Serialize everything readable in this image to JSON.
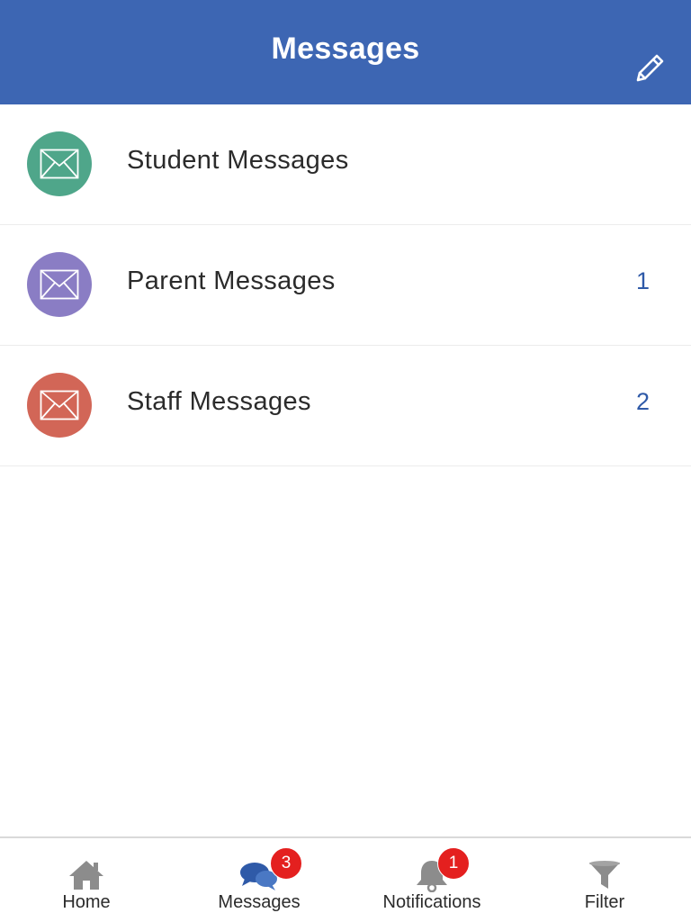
{
  "header": {
    "title": "Messages",
    "compose_icon": "pencil-icon",
    "background": "#3d66b3"
  },
  "list": {
    "items": [
      {
        "label": "Student Messages",
        "count": "",
        "icon": "envelope-icon",
        "color": "#4fa68a"
      },
      {
        "label": "Parent Messages",
        "count": "1",
        "icon": "envelope-icon",
        "color": "#8a7dc4"
      },
      {
        "label": "Staff Messages",
        "count": "2",
        "icon": "envelope-icon",
        "color": "#d26657"
      }
    ]
  },
  "tabbar": {
    "tabs": [
      {
        "label": "Home",
        "icon": "home-icon",
        "badge": ""
      },
      {
        "label": "Messages",
        "icon": "chat-bubbles-icon",
        "badge": "3",
        "active_color": "#2f5aa8"
      },
      {
        "label": "Notifications",
        "icon": "bell-icon",
        "badge": "1"
      },
      {
        "label": "Filter",
        "icon": "funnel-icon",
        "badge": ""
      }
    ],
    "badge_color": "#e4201f"
  }
}
